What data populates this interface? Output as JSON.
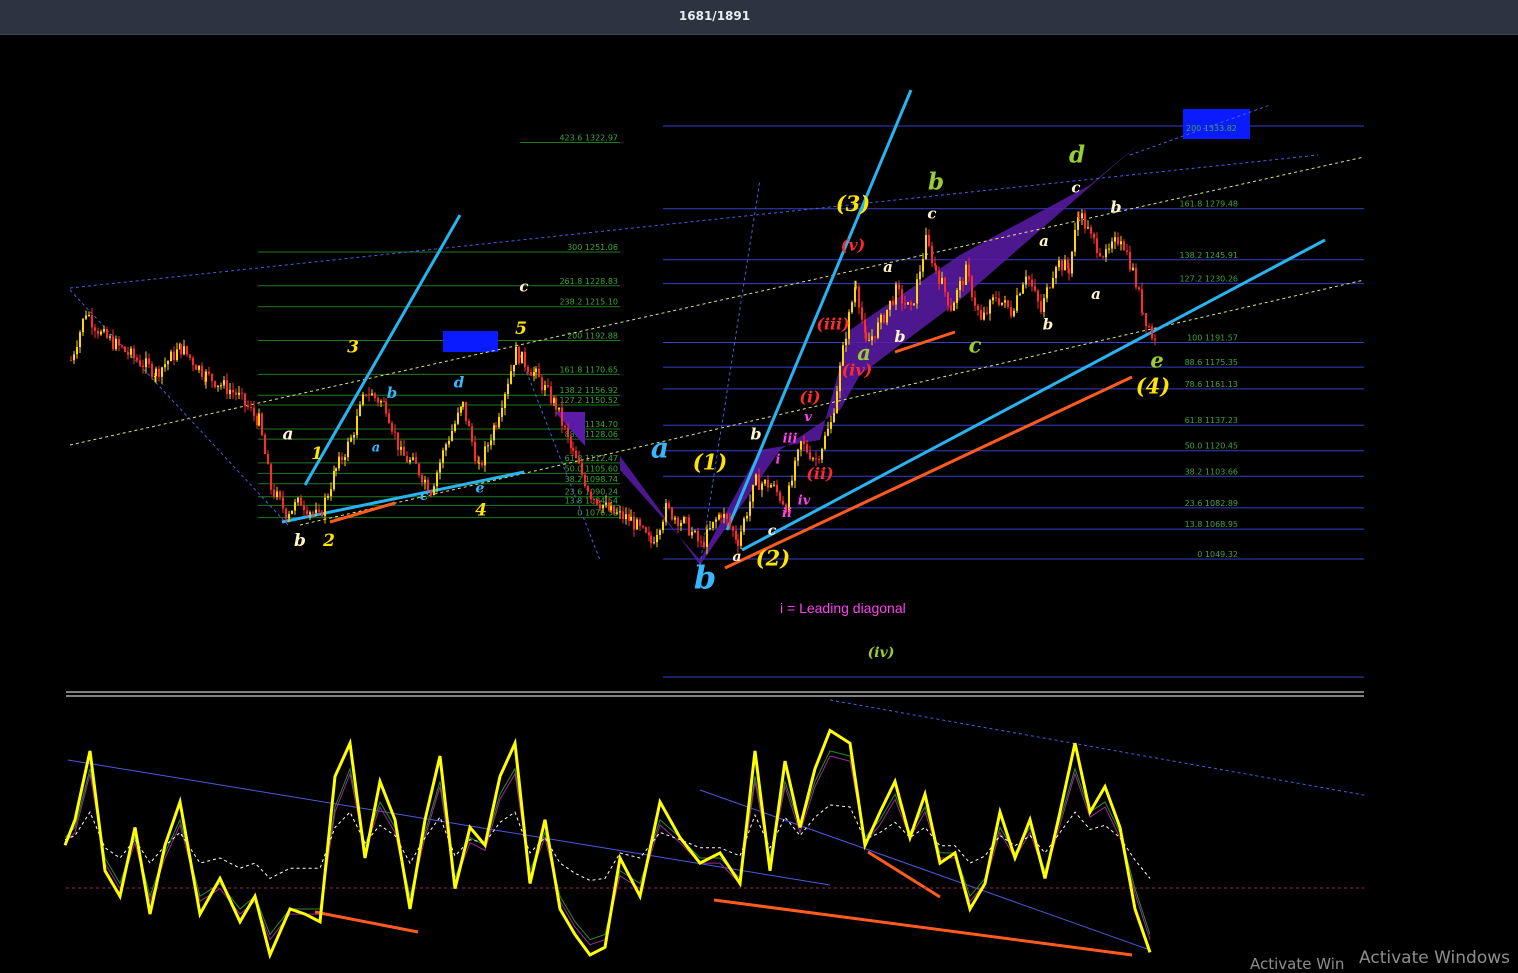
{
  "header": {
    "title": "1681/1891"
  },
  "annotation": "i = Leading diagonal",
  "watermark": [
    "Activate Windows",
    "Activate Win"
  ],
  "colors": {
    "background": "#000000",
    "bull": "#ffd700",
    "bear": "#ff2a2a",
    "fib_green": "#1f7a1f",
    "fib_blue": "#3340c8",
    "trend_cyan": "#27b4f0",
    "trend_orange": "#ff5a1f",
    "channel_purple": "#5b1ba8",
    "osc_yellow": "#ffff00"
  },
  "chart_data": [
    {
      "type": "candlestick",
      "ylim": [
        1040,
        1340
      ],
      "grid": false,
      "fib_levels_left": [
        {
          "label": "423.6 1322.97",
          "value": 1322.97
        },
        {
          "label": "300 1251.06",
          "value": 1251.06
        },
        {
          "label": "261.8 1228.83",
          "value": 1228.83
        },
        {
          "label": "238.2 1215.10",
          "value": 1215.1
        },
        {
          "label": "200 1192.88",
          "value": 1192.88
        },
        {
          "label": "161.8 1170.65",
          "value": 1170.65
        },
        {
          "label": "138.2 1156.92",
          "value": 1156.92
        },
        {
          "label": "127.2 1150.52",
          "value": 1150.52
        },
        {
          "label": "100 1134.70",
          "value": 1134.7
        },
        {
          "label": "88.6 1128.06",
          "value": 1128.06
        },
        {
          "label": "61.8 1112.47",
          "value": 1112.47
        },
        {
          "label": "50.0 1105.60",
          "value": 1105.6
        },
        {
          "label": "38.2 1098.74",
          "value": 1098.74
        },
        {
          "label": "23.6 1090.24",
          "value": 1090.24
        },
        {
          "label": "13.8 1084.54",
          "value": 1084.54
        },
        {
          "label": "0 1076.52",
          "value": 1076.52
        }
      ],
      "fib_levels_right": [
        {
          "label": "200 1333.82",
          "value": 1333.82
        },
        {
          "label": "161.8 1279.48",
          "value": 1279.48
        },
        {
          "label": "138.2 1245.91",
          "value": 1245.91
        },
        {
          "label": "127.2 1230.26",
          "value": 1230.26
        },
        {
          "label": "100 1191.57",
          "value": 1191.57
        },
        {
          "label": "88.6 1175.35",
          "value": 1175.35
        },
        {
          "label": "78.6 1161.13",
          "value": 1161.13
        },
        {
          "label": "61.8 1137.23",
          "value": 1137.23
        },
        {
          "label": "50.0 1120.45",
          "value": 1120.45
        },
        {
          "label": "38.2 1103.66",
          "value": 1103.66
        },
        {
          "label": "23.6 1082.89",
          "value": 1082.89
        },
        {
          "label": "13.8 1068.95",
          "value": 1068.95
        },
        {
          "label": "0 1049.32",
          "value": 1049.32
        }
      ],
      "price_path": [
        [
          70,
          1180
        ],
        [
          85,
          1212
        ],
        [
          100,
          1197
        ],
        [
          130,
          1183
        ],
        [
          155,
          1172
        ],
        [
          180,
          1188
        ],
        [
          205,
          1170
        ],
        [
          235,
          1158
        ],
        [
          258,
          1140
        ],
        [
          270,
          1096
        ],
        [
          285,
          1080
        ],
        [
          300,
          1087
        ],
        [
          318,
          1076
        ],
        [
          335,
          1108
        ],
        [
          350,
          1128
        ],
        [
          365,
          1160
        ],
        [
          385,
          1150
        ],
        [
          400,
          1118
        ],
        [
          415,
          1110
        ],
        [
          430,
          1095
        ],
        [
          445,
          1125
        ],
        [
          462,
          1150
        ],
        [
          478,
          1108
        ],
        [
          495,
          1140
        ],
        [
          515,
          1185
        ],
        [
          535,
          1170
        ],
        [
          555,
          1150
        ],
        [
          572,
          1118
        ],
        [
          590,
          1092
        ],
        [
          610,
          1080
        ],
        [
          630,
          1075
        ],
        [
          650,
          1060
        ],
        [
          665,
          1082
        ],
        [
          685,
          1072
        ],
        [
          700,
          1058
        ],
        [
          720,
          1080
        ],
        [
          737,
          1062
        ],
        [
          755,
          1100
        ],
        [
          770,
          1098
        ],
        [
          785,
          1085
        ],
        [
          800,
          1125
        ],
        [
          815,
          1115
        ],
        [
          830,
          1138
        ],
        [
          845,
          1198
        ],
        [
          855,
          1232
        ],
        [
          865,
          1190
        ],
        [
          880,
          1205
        ],
        [
          895,
          1225
        ],
        [
          910,
          1212
        ],
        [
          925,
          1258
        ],
        [
          935,
          1240
        ],
        [
          950,
          1215
        ],
        [
          965,
          1238
        ],
        [
          980,
          1205
        ],
        [
          995,
          1222
        ],
        [
          1010,
          1212
        ],
        [
          1025,
          1238
        ],
        [
          1040,
          1212
        ],
        [
          1055,
          1245
        ],
        [
          1068,
          1240
        ],
        [
          1078,
          1278
        ],
        [
          1090,
          1260
        ],
        [
          1105,
          1248
        ],
        [
          1120,
          1262
        ],
        [
          1132,
          1238
        ],
        [
          1142,
          1212
        ],
        [
          1155,
          1190
        ]
      ],
      "wave_labels": [
        {
          "text": "a",
          "x": 288,
          "price": 1128,
          "color": "#fff6c8",
          "size": 17
        },
        {
          "text": "b",
          "x": 300,
          "price": 1058,
          "color": "#fff6c8",
          "size": 17
        },
        {
          "text": "1",
          "x": 317,
          "price": 1115,
          "color": "#ffe400",
          "size": 17
        },
        {
          "text": "2",
          "x": 329,
          "price": 1058,
          "color": "#ffe400",
          "size": 17
        },
        {
          "text": "3",
          "x": 353,
          "price": 1185,
          "color": "#ffe400",
          "size": 17
        },
        {
          "text": "b",
          "x": 392,
          "price": 1155,
          "color": "#36b8ff",
          "size": 15
        },
        {
          "text": "a",
          "x": 376,
          "price": 1120,
          "color": "#36b8ff",
          "size": 13
        },
        {
          "text": "c",
          "x": 424,
          "price": 1088,
          "color": "#36b8ff",
          "size": 14
        },
        {
          "text": "d",
          "x": 459,
          "price": 1162,
          "color": "#36b8ff",
          "size": 15
        },
        {
          "text": "e",
          "x": 480,
          "price": 1093,
          "color": "#36b8ff",
          "size": 14
        },
        {
          "text": "4",
          "x": 481,
          "price": 1078,
          "color": "#ffe400",
          "size": 17
        },
        {
          "text": "5",
          "x": 521,
          "price": 1197,
          "color": "#ffe400",
          "size": 17
        },
        {
          "text": "c",
          "x": 524,
          "price": 1225,
          "color": "#fff6c8",
          "size": 15
        },
        {
          "text": "a",
          "x": 660,
          "price": 1116,
          "color": "#36b8ff",
          "size": 28
        },
        {
          "text": "b",
          "x": 705,
          "price": 1030,
          "color": "#36b8ff",
          "size": 32
        },
        {
          "text": "(1)",
          "x": 710,
          "price": 1108,
          "color": "#ffe400",
          "size": 21
        },
        {
          "text": "(2)",
          "x": 773,
          "price": 1045,
          "color": "#ffe400",
          "size": 21
        },
        {
          "text": "a",
          "x": 737,
          "price": 1048,
          "color": "#fff6c8",
          "size": 14
        },
        {
          "text": "b",
          "x": 756,
          "price": 1128,
          "color": "#fff6c8",
          "size": 16
        },
        {
          "text": "c",
          "x": 772,
          "price": 1065,
          "color": "#fff6c8",
          "size": 14
        },
        {
          "text": "i",
          "x": 778,
          "price": 1112,
          "color": "#ff3ff0",
          "size": 13
        },
        {
          "text": "ii",
          "x": 787,
          "price": 1077,
          "color": "#ff3ff0",
          "size": 13
        },
        {
          "text": "iii",
          "x": 790,
          "price": 1126,
          "color": "#ff3ff0",
          "size": 13
        },
        {
          "text": "iv",
          "x": 804,
          "price": 1085,
          "color": "#ff3ff0",
          "size": 13
        },
        {
          "text": "v",
          "x": 808,
          "price": 1140,
          "color": "#ff3ff0",
          "size": 13
        },
        {
          "text": "(i)",
          "x": 810,
          "price": 1152,
          "color": "#ff2a2a",
          "size": 16
        },
        {
          "text": "(ii)",
          "x": 820,
          "price": 1102,
          "color": "#ff2a2a",
          "size": 16
        },
        {
          "text": "(iii)",
          "x": 833,
          "price": 1200,
          "color": "#ff2a2a",
          "size": 16
        },
        {
          "text": "(iv)",
          "x": 857,
          "price": 1170,
          "color": "#ff2a2a",
          "size": 16
        },
        {
          "text": "(v)",
          "x": 853,
          "price": 1252,
          "color": "#ff2a2a",
          "size": 16
        },
        {
          "text": "(3)",
          "x": 853,
          "price": 1278,
          "color": "#ffe400",
          "size": 21
        },
        {
          "text": "a",
          "x": 864,
          "price": 1180,
          "color": "#9acd32",
          "size": 21
        },
        {
          "text": "b",
          "x": 900,
          "price": 1192,
          "color": "#fff6c8",
          "size": 16
        },
        {
          "text": "a",
          "x": 888,
          "price": 1238,
          "color": "#fff6c8",
          "size": 15
        },
        {
          "text": "b",
          "x": 936,
          "price": 1292,
          "color": "#9acd32",
          "size": 23
        },
        {
          "text": "c",
          "x": 932,
          "price": 1273,
          "color": "#fff6c8",
          "size": 15
        },
        {
          "text": "c",
          "x": 975,
          "price": 1185,
          "color": "#9acd32",
          "size": 21
        },
        {
          "text": "a",
          "x": 1044,
          "price": 1255,
          "color": "#fff6c8",
          "size": 15
        },
        {
          "text": "b",
          "x": 1048,
          "price": 1200,
          "color": "#fff6c8",
          "size": 15
        },
        {
          "text": "d",
          "x": 1077,
          "price": 1310,
          "color": "#9acd32",
          "size": 23
        },
        {
          "text": "c",
          "x": 1076,
          "price": 1290,
          "color": "#fff6c8",
          "size": 15
        },
        {
          "text": "a",
          "x": 1096,
          "price": 1220,
          "color": "#fff6c8",
          "size": 15
        },
        {
          "text": "b",
          "x": 1116,
          "price": 1277,
          "color": "#fff6c8",
          "size": 16
        },
        {
          "text": "e",
          "x": 1157,
          "price": 1175,
          "color": "#9acd32",
          "size": 21
        },
        {
          "text": "(4)",
          "x": 1153,
          "price": 1158,
          "color": "#ffe400",
          "size": 21
        },
        {
          "text": "(iv)",
          "x": 881,
          "price": 985,
          "color": "#9acd32",
          "size": 14
        }
      ]
    },
    {
      "type": "line",
      "ylim": [
        0,
        100
      ],
      "x": [
        65,
        75,
        90,
        105,
        120,
        135,
        150,
        165,
        180,
        200,
        220,
        240,
        255,
        270,
        290,
        305,
        320,
        335,
        350,
        365,
        380,
        395,
        410,
        425,
        440,
        455,
        470,
        485,
        500,
        515,
        530,
        545,
        560,
        575,
        590,
        605,
        620,
        640,
        660,
        680,
        700,
        720,
        740,
        755,
        770,
        785,
        800,
        815,
        830,
        850,
        865,
        880,
        895,
        910,
        925,
        940,
        955,
        970,
        985,
        1000,
        1015,
        1030,
        1045,
        1060,
        1075,
        1090,
        1105,
        1120,
        1135,
        1150
      ],
      "series": [
        {
          "values": [
            45,
            55,
            82,
            35,
            25,
            52,
            18,
            45,
            62,
            18,
            32,
            15,
            25,
            2,
            20,
            18,
            15,
            72,
            85,
            40,
            70,
            55,
            20,
            55,
            80,
            28,
            52,
            45,
            72,
            85,
            30,
            55,
            20,
            10,
            2,
            5,
            40,
            25,
            62,
            48,
            38,
            42,
            30,
            82,
            35,
            78,
            52,
            75,
            90,
            85,
            45,
            58,
            70,
            48,
            65,
            38,
            42,
            20,
            30,
            58,
            40,
            55,
            32,
            58,
            85,
            58,
            68,
            52,
            20,
            3
          ]
        },
        {
          "values": [
            48,
            52,
            75,
            40,
            30,
            48,
            25,
            42,
            55,
            25,
            30,
            20,
            25,
            10,
            20,
            20,
            20,
            60,
            75,
            45,
            62,
            52,
            25,
            50,
            70,
            32,
            48,
            45,
            65,
            75,
            35,
            50,
            25,
            15,
            8,
            10,
            35,
            30,
            55,
            48,
            40,
            40,
            32,
            72,
            40,
            70,
            52,
            70,
            82,
            80,
            48,
            55,
            65,
            50,
            60,
            42,
            42,
            25,
            32,
            52,
            42,
            52,
            35,
            55,
            75,
            58,
            62,
            50,
            28,
            10
          ]
        }
      ]
    }
  ]
}
